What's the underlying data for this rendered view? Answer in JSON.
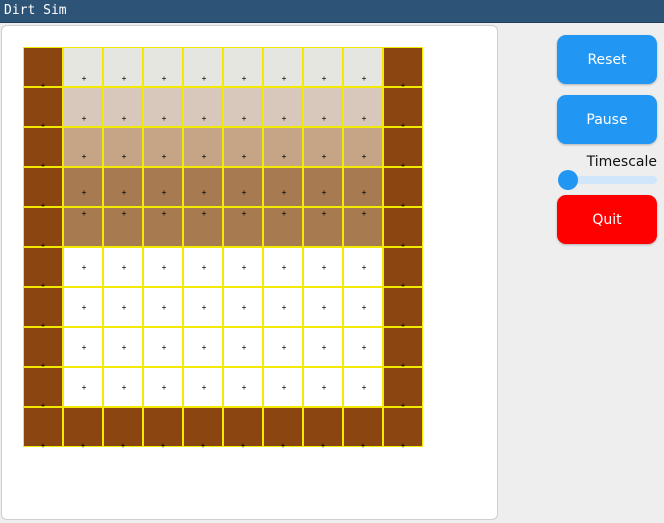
{
  "window": {
    "title": "Dirt Sim"
  },
  "controls": {
    "reset_label": "Reset",
    "pause_label": "Pause",
    "timescale_label": "Timescale",
    "timescale_value": 0.0,
    "quit_label": "Quit"
  },
  "colors": {
    "wall": "#8a4511",
    "grid_line": "#f2ea00",
    "empty": "#ffffff",
    "button_blue": "#2196f3",
    "button_red": "#ff0000",
    "rows": [
      "#e6e6e0",
      "#d8c8bc",
      "#c6a586",
      "#a77a52",
      "#a87a50"
    ]
  },
  "grid": {
    "cols": 10,
    "rows": 10,
    "cells": [
      [
        "wall",
        "r0",
        "r0",
        "r0",
        "r0",
        "r0",
        "r0",
        "r0",
        "r0",
        "wall"
      ],
      [
        "wall",
        "r1",
        "r1",
        "r1",
        "r1",
        "r1",
        "r1",
        "r1",
        "r1",
        "wall"
      ],
      [
        "wall",
        "r2",
        "r2",
        "r2",
        "r2",
        "r2",
        "r2",
        "r2",
        "r2",
        "wall"
      ],
      [
        "wall",
        "r3",
        "r3",
        "r3",
        "r3",
        "r3",
        "r3",
        "r3",
        "r3",
        "wall"
      ],
      [
        "wall",
        "r4",
        "r4",
        "r4",
        "r4",
        "r4",
        "r4",
        "r4",
        "r4",
        "wall"
      ],
      [
        "wall",
        "empty",
        "empty",
        "empty",
        "empty",
        "empty",
        "empty",
        "empty",
        "empty",
        "wall"
      ],
      [
        "wall",
        "empty",
        "empty",
        "empty",
        "empty",
        "empty",
        "empty",
        "empty",
        "empty",
        "wall"
      ],
      [
        "wall",
        "empty",
        "empty",
        "empty",
        "empty",
        "empty",
        "empty",
        "empty",
        "empty",
        "wall"
      ],
      [
        "wall",
        "empty",
        "empty",
        "empty",
        "empty",
        "empty",
        "empty",
        "empty",
        "empty",
        "wall"
      ],
      [
        "wall",
        "wall",
        "wall",
        "wall",
        "wall",
        "wall",
        "wall",
        "wall",
        "wall",
        "wall"
      ]
    ]
  }
}
